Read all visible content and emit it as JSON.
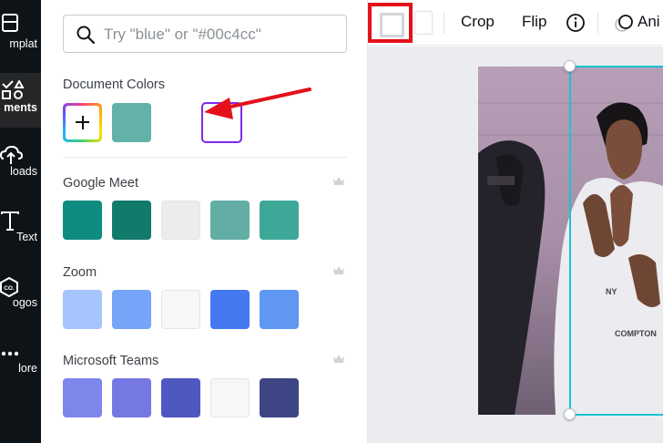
{
  "rail": {
    "items": [
      {
        "label": "mplat",
        "icon": "templates-icon"
      },
      {
        "label": "ments",
        "icon": "elements-icon"
      },
      {
        "label": "loads",
        "icon": "uploads-icon"
      },
      {
        "label": "Text",
        "icon": "text-icon"
      },
      {
        "label": "ogos",
        "icon": "logos-icon"
      },
      {
        "label": "lore",
        "icon": "more-icon"
      }
    ],
    "logos_badge": "CO."
  },
  "panel": {
    "search": {
      "placeholder": "Try \"blue\" or \"#00c4cc\""
    },
    "document_colors": {
      "title": "Document Colors",
      "swatches": [
        "#63b2a9",
        "#ffffff"
      ]
    },
    "palettes": [
      {
        "title": "Google Meet",
        "colors": [
          "#0e8c7f",
          "#127a6a",
          "#ececec",
          "#62aea5",
          "#3ea898"
        ]
      },
      {
        "title": "Zoom",
        "colors": [
          "#a6c5fc",
          "#76a4f8",
          "#f7f7f7",
          "#4479f1",
          "#5f97f3"
        ]
      },
      {
        "title": "Microsoft Teams",
        "colors": [
          "#7d86eb",
          "#7578e2",
          "#4f57c1",
          "#f7f7f7",
          "#3e4584"
        ]
      }
    ]
  },
  "toolbar": {
    "crop": "Crop",
    "flip": "Flip",
    "animate": "Ani"
  },
  "colors": {
    "accent_purple": "#7d2ae8",
    "highlight_red": "#e3111b",
    "selection_cyan": "#19c4d3",
    "rail_bg": "#0e1318"
  }
}
